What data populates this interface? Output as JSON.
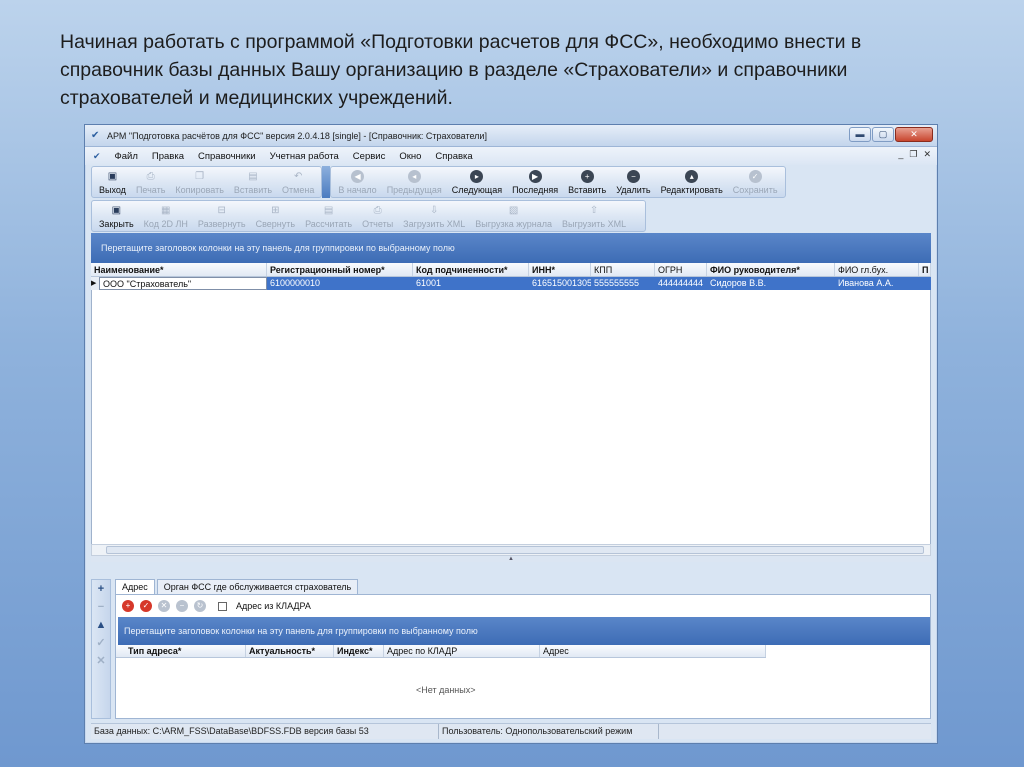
{
  "slide": {
    "line1": "Начиная работать с программой «Подготовки расчетов для ФСС», необходимо внести в",
    "line2": "справочник базы данных Вашу организацию в разделе «Страхователи» и справочники",
    "line3": "страхователей и медицинских учреждений."
  },
  "window": {
    "title": "АРМ \"Подготовка расчётов для ФСС\"  версия 2.0.4.18 [single] - [Справочник: Страхователи]",
    "btn_min": "▬",
    "btn_max": "▢",
    "btn_close": "✕"
  },
  "menu": {
    "items": [
      "Файл",
      "Правка",
      "Справочники",
      "Учетная работа",
      "Сервис",
      "Окно",
      "Справка"
    ],
    "mdi_min": "_",
    "mdi_restore": "❐",
    "mdi_close": "✕"
  },
  "toolbar1": {
    "exit": "Выход",
    "print": "Печать",
    "copy": "Копировать",
    "paste": "Вставить",
    "undo": "Отмена",
    "first": "В начало",
    "prev": "Предыдущая",
    "next": "Следующая",
    "last": "Последняя",
    "insert": "Вставить",
    "delete": "Удалить",
    "edit": "Редактировать",
    "save": "Сохранить"
  },
  "toolbar2": {
    "close": "Закрыть",
    "code2d": "Код 2D  ЛН",
    "expand": "Развернуть",
    "collapse": "Свернуть",
    "calculate": "Рассчитать",
    "reports": "Отчеты",
    "load_xml": "Загрузить XML",
    "journal": "Выгрузка журнала",
    "unload_xml": "Выгрузить XML"
  },
  "grid": {
    "group_hint": "Перетащите заголовок колонки на эту панель для группировки по выбранному полю",
    "columns": [
      "Наименование*",
      "Регистрационный номер*",
      "Код подчиненности*",
      "ИНН*",
      "КПП",
      "ОГРН",
      "ФИО руководителя*",
      "ФИО гл.бух.",
      "П"
    ],
    "row": [
      "ООО \"Страхователь\"",
      "6100000010",
      "61001",
      "616515001305",
      "555555555",
      "444444444",
      "Сидоров В.В.",
      "Иванова А.А.",
      ""
    ]
  },
  "lower": {
    "tabs": [
      "Адрес",
      "Орган ФСС где обслуживается страхователь"
    ],
    "checkbox_label": "Адрес из КЛАДРА",
    "group_hint": "Перетащите заголовок колонки на эту панель для группировки по выбранному полю",
    "columns": [
      "Тип адреса*",
      "Актуальность*",
      "Индекс*",
      "Адрес по КЛАДР",
      "Адрес"
    ],
    "empty": "<Нет данных>"
  },
  "status": {
    "db": "База данных: C:\\ARM_FSS\\DataBase\\BDFSS.FDB  версия базы 53",
    "user": "Пользователь: Однопользовательский режим"
  }
}
